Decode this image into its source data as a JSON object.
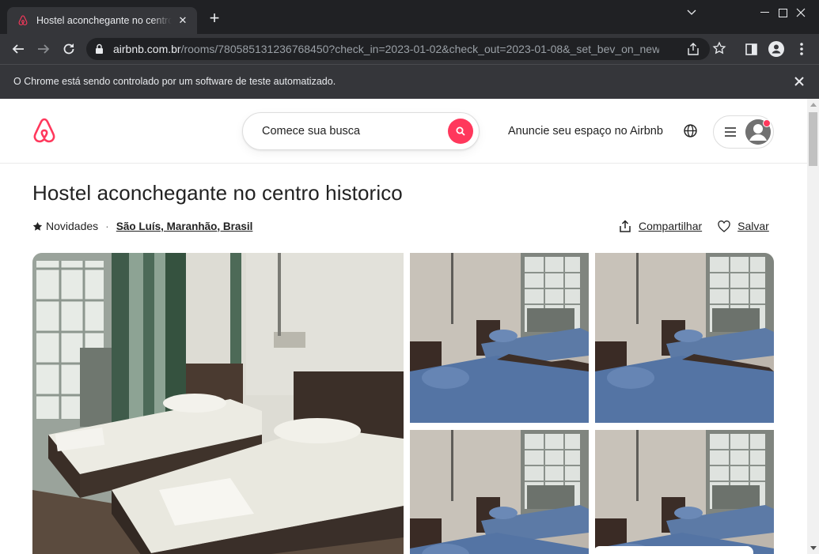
{
  "browser": {
    "tab_title": "Hostel aconchegante no centro historico",
    "url_host": "airbnb.com.br",
    "url_path": "/rooms/780585131236768450?check_in=2023-01-02&check_out=2023-01-08&_set_bev_on_new_do...",
    "infobar_text": "O Chrome está sendo controlado por um software de teste automatizado."
  },
  "header": {
    "search_placeholder": "Comece sua busca",
    "host_link": "Anuncie seu espaço no Airbnb"
  },
  "listing": {
    "title": "Hostel aconchegante no centro historico",
    "rating_label": "Novidades",
    "separator": "·",
    "location": "São Luís, Maranhão, Brasil",
    "share_label": "Compartilhar",
    "save_label": "Salvar"
  },
  "colors": {
    "brand": "#ff385c",
    "chrome_dark": "#202124",
    "chrome_toolbar": "#35363a"
  },
  "icons": [
    "airbnb-logo-icon",
    "search-icon",
    "globe-icon",
    "menu-icon",
    "user-avatar-icon",
    "star-icon",
    "share-icon",
    "heart-icon"
  ]
}
